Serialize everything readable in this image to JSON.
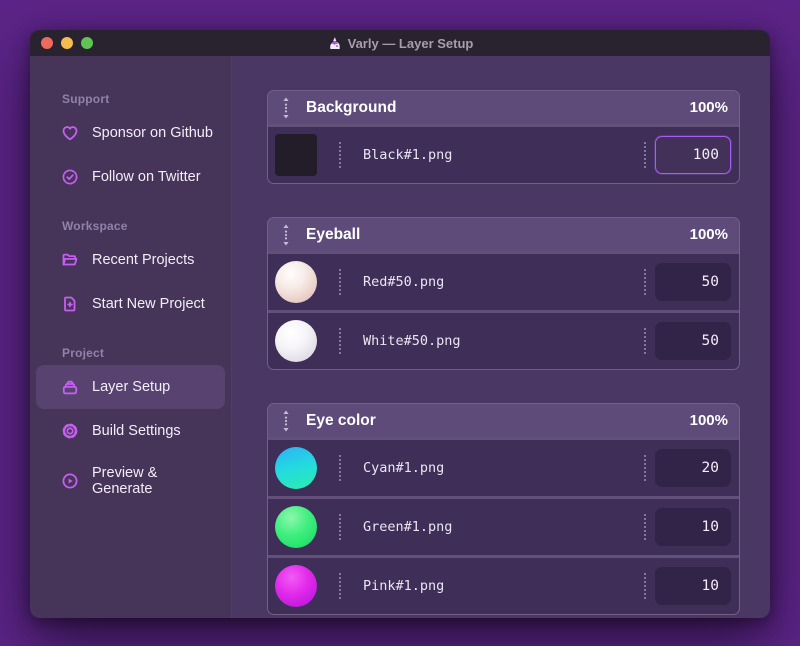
{
  "window": {
    "title": "Varly — Layer Setup"
  },
  "sidebar": {
    "sections": [
      {
        "label": "Support",
        "items": [
          {
            "icon": "heart-icon",
            "label": "Sponsor on Github"
          },
          {
            "icon": "badge-check-icon",
            "label": "Follow on Twitter"
          }
        ]
      },
      {
        "label": "Workspace",
        "items": [
          {
            "icon": "folder-open-icon",
            "label": "Recent Projects"
          },
          {
            "icon": "file-plus-icon",
            "label": "Start New Project"
          }
        ]
      },
      {
        "label": "Project",
        "items": [
          {
            "icon": "layers-icon",
            "label": "Layer Setup",
            "selected": true
          },
          {
            "icon": "gear-icon",
            "label": "Build Settings"
          },
          {
            "icon": "play-circle-icon",
            "label": "Preview & Generate"
          }
        ]
      }
    ]
  },
  "main": {
    "groups": [
      {
        "name": "Background",
        "opacity": "100%",
        "rows": [
          {
            "thumb": "black-square",
            "thumb_color": "#231c29",
            "filename": "Black#1.png",
            "value": "100",
            "focused": true
          }
        ]
      },
      {
        "name": "Eyeball",
        "opacity": "100%",
        "rows": [
          {
            "thumb": "red-sphere",
            "thumb_color": "#e9cfc8",
            "filename": "Red#50.png",
            "value": "50"
          },
          {
            "thumb": "white-sphere",
            "thumb_color": "#f6f4f8",
            "filename": "White#50.png",
            "value": "50"
          }
        ]
      },
      {
        "name": "Eye color",
        "opacity": "100%",
        "rows": [
          {
            "thumb": "cyan-sphere",
            "thumb_color": "#23d8e2",
            "filename": "Cyan#1.png",
            "value": "20"
          },
          {
            "thumb": "green-sphere",
            "thumb_color": "#3eee7e",
            "filename": "Green#1.png",
            "value": "10"
          },
          {
            "thumb": "pink-sphere",
            "thumb_color": "#e228ea",
            "filename": "Pink#1.png",
            "value": "10"
          }
        ]
      }
    ]
  },
  "colors": {
    "accent_focus_border": "#a95cf2",
    "sidebar_icon": "#c55ff0",
    "traffic_red": "#ee6a5f",
    "traffic_yellow": "#f5bd4f",
    "traffic_green": "#5fc454"
  }
}
